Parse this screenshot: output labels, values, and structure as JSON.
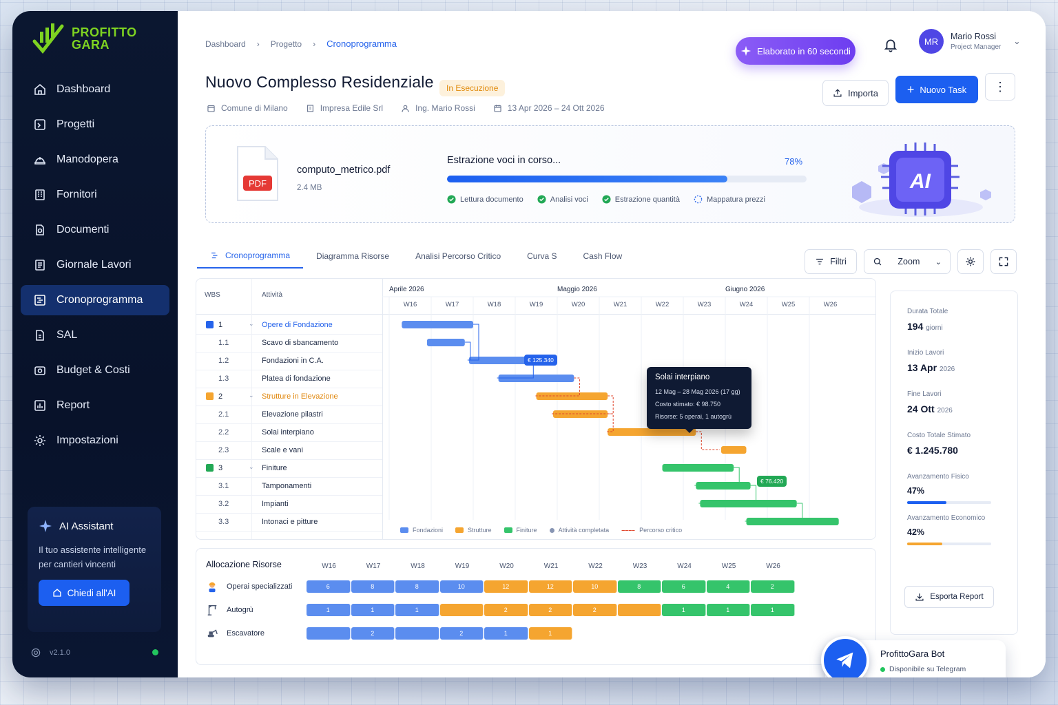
{
  "brand": {
    "name_line1": "PROFITTO",
    "name_line2": "GARA",
    "accent": "#7ed321"
  },
  "sidebar": {
    "items": [
      {
        "label": "Dashboard",
        "icon": "home-icon"
      },
      {
        "label": "Progetti",
        "icon": "folder-icon"
      },
      {
        "label": "Manodopera",
        "icon": "helmet-icon"
      },
      {
        "label": "Fornitori",
        "icon": "building-icon"
      },
      {
        "label": "Documenti",
        "icon": "document-icon"
      },
      {
        "label": "Giornale Lavori",
        "icon": "journal-icon"
      },
      {
        "label": "Cronoprogramma",
        "icon": "gantt-icon",
        "active": true
      },
      {
        "label": "SAL",
        "icon": "file-icon"
      },
      {
        "label": "Budget & Costi",
        "icon": "wallet-icon"
      },
      {
        "label": "Report",
        "icon": "report-icon"
      },
      {
        "label": "Impostazioni",
        "icon": "gear-icon"
      }
    ],
    "assistant": {
      "title": "AI Assistant",
      "description": "Il tuo assistente intelligente per cantieri vincenti",
      "button": "Chiedi all'AI"
    },
    "version": "v2.1.0"
  },
  "header": {
    "breadcrumb": [
      "Dashboard",
      "Progetto",
      "Cronoprogramma"
    ],
    "ai_pill": "Elaborato in 60 secondi",
    "user": {
      "initials": "MR",
      "name": "Mario Rossi",
      "role": "Project Manager"
    }
  },
  "project": {
    "title": "Nuovo Complesso Residenziale",
    "status": "In Esecuzione",
    "client": "Comune di Milano",
    "contractor": "Impresa Edile Srl",
    "engineer": "Ing. Mario Rossi",
    "dates": "13 Apr 2026 – 24 Ott 2026",
    "actions": {
      "import": "Importa",
      "new_task": "Nuovo Task"
    }
  },
  "upload": {
    "file_badge": "PDF",
    "file_name": "computo_metrico.pdf",
    "file_size": "2.4 MB",
    "title": "Estrazione voci in corso...",
    "progress_label": "78%",
    "progress": 0.78,
    "steps": [
      {
        "label": "Lettura documento",
        "done": true
      },
      {
        "label": "Analisi voci",
        "done": true
      },
      {
        "label": "Estrazione quantità",
        "done": true
      },
      {
        "label": "Mappatura prezzi",
        "done": false
      }
    ],
    "chip_label": "AI"
  },
  "tabs": [
    "Cronoprogramma",
    "Diagramma Risorse",
    "Analisi Percorso Critico",
    "Curva S",
    "Cash Flow"
  ],
  "toolbar": {
    "filters": "Filtri",
    "zoom": "Zoom"
  },
  "gantt": {
    "col_wbs": "WBS",
    "col_activity": "Attività",
    "months": [
      "Aprile 2026",
      "Maggio 2026",
      "Giugno 2026"
    ],
    "weeks": [
      "W16",
      "W17",
      "W18",
      "W19",
      "W20",
      "W21",
      "W22",
      "W23",
      "W24",
      "W25",
      "W26"
    ],
    "rows": [
      {
        "wbs": "1",
        "activity": "Opere di Fondazione",
        "group": "blue",
        "start": 0.3,
        "end": 2.0
      },
      {
        "wbs": "1.1",
        "activity": "Scavo di sbancamento",
        "group": "blue",
        "start": 0.9,
        "end": 1.8
      },
      {
        "wbs": "1.2",
        "activity": "Fondazioni in C.A.",
        "group": "blue",
        "start": 1.9,
        "end": 3.3
      },
      {
        "wbs": "1.3",
        "activity": "Platea di fondazione",
        "group": "blue",
        "start": 2.6,
        "end": 4.4
      },
      {
        "wbs": "2",
        "activity": "Strutture in Elevazione",
        "group": "orange",
        "start": 3.5,
        "end": 5.2
      },
      {
        "wbs": "2.1",
        "activity": "Elevazione pilastri",
        "group": "orange",
        "start": 3.9,
        "end": 5.2
      },
      {
        "wbs": "2.2",
        "activity": "Solai interpiano",
        "group": "orange",
        "start": 5.2,
        "end": 7.3
      },
      {
        "wbs": "2.3",
        "activity": "Scale e vani",
        "group": "orange",
        "start": 7.9,
        "end": 8.5
      },
      {
        "wbs": "3",
        "activity": "Finiture",
        "group": "green",
        "start": 6.5,
        "end": 8.2
      },
      {
        "wbs": "3.1",
        "activity": "Tamponamenti",
        "group": "green",
        "start": 7.3,
        "end": 8.6
      },
      {
        "wbs": "3.2",
        "activity": "Impianti",
        "group": "green",
        "start": 7.4,
        "end": 9.7
      },
      {
        "wbs": "3.3",
        "activity": "Intonaci e pitture",
        "group": "green",
        "start": 8.5,
        "end": 10.7
      }
    ],
    "money_badges": [
      {
        "label": "€ 125.340",
        "color": "#2563eb"
      },
      {
        "label": "€ 76.420",
        "color": "#22a855"
      }
    ],
    "tooltip": {
      "title": "Solai interpiano",
      "dates": "12 Mag – 28 Mag 2026 (17 gg)",
      "cost": "Costo stimato: € 98.750",
      "resources": "Risorse: 5 operai, 1 autogrù"
    },
    "legend": [
      {
        "label": "Fondazioni",
        "color": "#5b8def"
      },
      {
        "label": "Strutture",
        "color": "#f5a530"
      },
      {
        "label": "Finiture",
        "color": "#35c46b"
      },
      {
        "label": "Attività completata",
        "color": "#8795b3"
      },
      {
        "label": "Percorso critico",
        "color": "#e0452b"
      }
    ],
    "colors": {
      "blue": "#5b8def",
      "orange": "#f5a530",
      "green": "#35c46b"
    }
  },
  "resources": {
    "title": "Allocazione Risorse",
    "weeks": [
      "W16",
      "W17",
      "W18",
      "W19",
      "W20",
      "W21",
      "W22",
      "W23",
      "W24",
      "W25",
      "W26"
    ],
    "rows": [
      {
        "name": "Operai specializzati",
        "icon": "worker-icon",
        "values": [
          "6",
          "8",
          "8",
          "10",
          "12",
          "12",
          "10",
          "8",
          "6",
          "4",
          "2"
        ],
        "colors": [
          "b",
          "b",
          "b",
          "b",
          "o",
          "o",
          "o",
          "g",
          "g",
          "g",
          "g"
        ]
      },
      {
        "name": "Autogrù",
        "icon": "crane-icon",
        "values": [
          "1",
          "1",
          "1",
          "",
          "2",
          "2",
          "2",
          "",
          "1",
          "1",
          "1"
        ],
        "colors": [
          "b",
          "b",
          "b",
          "o",
          "o",
          "o",
          "o",
          "o",
          "g",
          "g",
          "g"
        ]
      },
      {
        "name": "Escavatore",
        "icon": "excavator-icon",
        "values": [
          "",
          "2",
          "",
          "2",
          "1",
          "1"
        ],
        "colors": [
          "b",
          "b",
          "b",
          "b",
          "b",
          "o"
        ]
      }
    ]
  },
  "kpis": [
    {
      "label": "Durata Totale",
      "value": "194",
      "unit": "giorni"
    },
    {
      "label": "Inizio Lavori",
      "value": "13 Apr",
      "unit": "2026"
    },
    {
      "label": "Fine Lavori",
      "value": "24 Ott",
      "unit": "2026"
    },
    {
      "label": "Costo Totale Stimato",
      "value": "€ 1.245.780",
      "unit": ""
    },
    {
      "label": "Avanzamento Fisico",
      "value": "47%",
      "unit": "",
      "progress": 0.47,
      "color": "#1c5ff0"
    },
    {
      "label": "Avanzamento Economico",
      "value": "42%",
      "unit": "",
      "progress": 0.42,
      "color": "#f5a530"
    }
  ],
  "export_label": "Esporta Report",
  "bot": {
    "name": "ProfittoGara Bot",
    "status": "Disponibile su Telegram"
  }
}
